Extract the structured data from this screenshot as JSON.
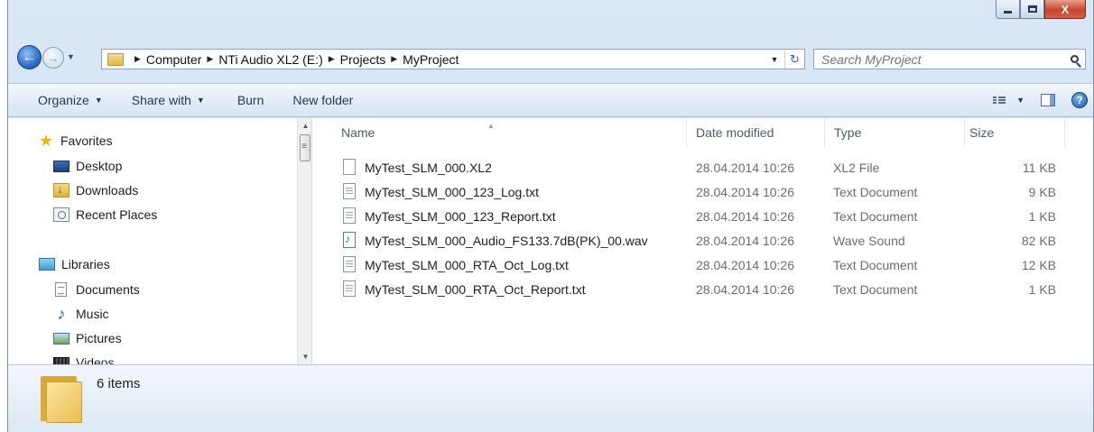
{
  "window": {
    "caption_buttons": {
      "minimize": "minimize",
      "maximize": "maximize",
      "close": "X"
    }
  },
  "address": {
    "crumbs": [
      "Computer",
      "NTi Audio XL2 (E:)",
      "Projects",
      "MyProject"
    ],
    "search_placeholder": "Search MyProject"
  },
  "toolbar": {
    "organize": "Organize",
    "share_with": "Share with",
    "burn": "Burn",
    "new_folder": "New folder"
  },
  "nav": {
    "favorites": "Favorites",
    "desktop": "Desktop",
    "downloads": "Downloads",
    "recent_places": "Recent Places",
    "libraries": "Libraries",
    "documents": "Documents",
    "music": "Music",
    "pictures": "Pictures",
    "videos": "Videos"
  },
  "columns": {
    "name": "Name",
    "date": "Date modified",
    "type": "Type",
    "size": "Size"
  },
  "files": [
    {
      "name": "MyTest_SLM_000.XL2",
      "date": "28.04.2014 10:26",
      "type": "XL2 File",
      "size": "11 KB",
      "icon": "blank-file-icon"
    },
    {
      "name": "MyTest_SLM_000_123_Log.txt",
      "date": "28.04.2014 10:26",
      "type": "Text Document",
      "size": "9 KB",
      "icon": "text-file-icon"
    },
    {
      "name": "MyTest_SLM_000_123_Report.txt",
      "date": "28.04.2014 10:26",
      "type": "Text Document",
      "size": "1 KB",
      "icon": "text-file-icon"
    },
    {
      "name": "MyTest_SLM_000_Audio_FS133.7dB(PK)_00.wav",
      "date": "28.04.2014 10:26",
      "type": "Wave Sound",
      "size": "82 KB",
      "icon": "audio-file-icon"
    },
    {
      "name": "MyTest_SLM_000_RTA_Oct_Log.txt",
      "date": "28.04.2014 10:26",
      "type": "Text Document",
      "size": "12 KB",
      "icon": "text-file-icon"
    },
    {
      "name": "MyTest_SLM_000_RTA_Oct_Report.txt",
      "date": "28.04.2014 10:26",
      "type": "Text Document",
      "size": "1 KB",
      "icon": "text-file-icon"
    }
  ],
  "status": {
    "item_count": "6 items"
  },
  "colors": {
    "accent": "#1e395b",
    "close": "#c8452c",
    "chrome": "#d9e7f6"
  }
}
